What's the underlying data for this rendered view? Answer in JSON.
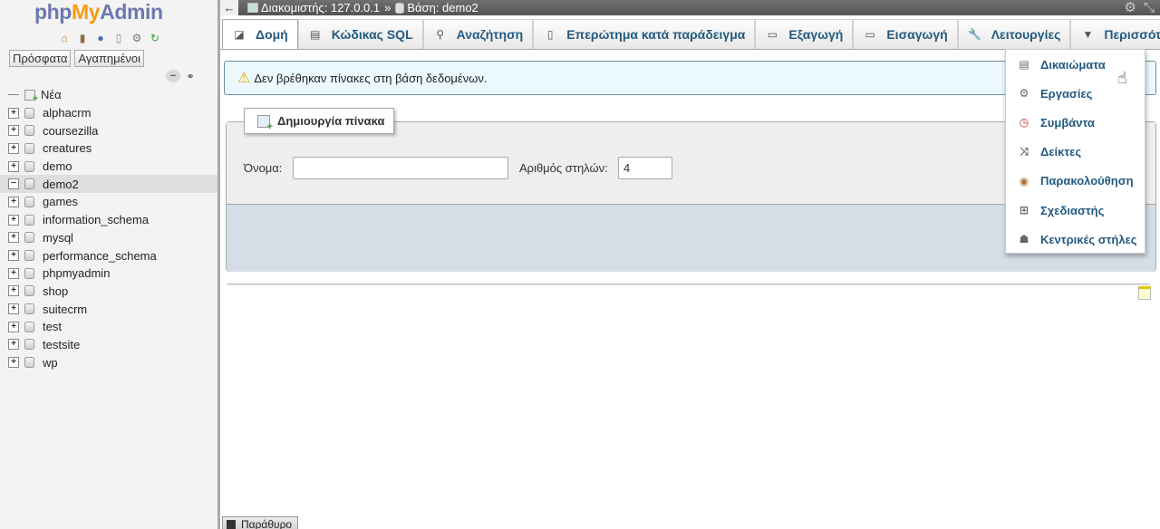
{
  "logo": {
    "php": "php",
    "my": "My",
    "admin": "Admin"
  },
  "nav": {
    "icons": [
      "home-icon",
      "exit-icon",
      "help-icon",
      "docs-icon",
      "settings-icon",
      "reload-icon"
    ],
    "tabs": {
      "recent": "Πρόσφατα",
      "favorites": "Αγαπημένοι"
    },
    "new_label": "Νέα",
    "databases": [
      "alphacrm",
      "coursezilla",
      "creatures",
      "demo",
      "demo2",
      "games",
      "information_schema",
      "mysql",
      "performance_schema",
      "phpmyadmin",
      "shop",
      "suitecrm",
      "test",
      "testsite",
      "wp"
    ],
    "selected": "demo2"
  },
  "breadcrumb": {
    "server": "Διακομιστής: 127.0.0.1",
    "separator": "»",
    "database": "Βάση: demo2"
  },
  "tabs": {
    "structure": "Δομή",
    "sql": "Κώδικας SQL",
    "search": "Αναζήτηση",
    "query": "Επερώτημα κατά παράδειγμα",
    "export": "Εξαγωγή",
    "import": "Εισαγωγή",
    "operations": "Λειτουργίες",
    "more": "Περισσότερα"
  },
  "notice": {
    "text": "Δεν βρέθηκαν πίνακες στη βάση δεδομένων."
  },
  "create_table": {
    "legend": "Δημιουργία πίνακα",
    "name_label": "Όνομα:",
    "name_value": "",
    "columns_label": "Αριθμός στηλών:",
    "columns_value": "4"
  },
  "more_menu": {
    "items": [
      "Δικαιώματα",
      "Εργασίες",
      "Συμβάντα",
      "Δείκτες",
      "Παρακολούθηση",
      "Σχεδιαστής",
      "Κεντρικές στήλες"
    ]
  },
  "console": {
    "label": "Παράθυρο"
  },
  "colors": {
    "link": "#235a81",
    "accent": "#f89c0e",
    "topbar": "#5f5f5f"
  }
}
